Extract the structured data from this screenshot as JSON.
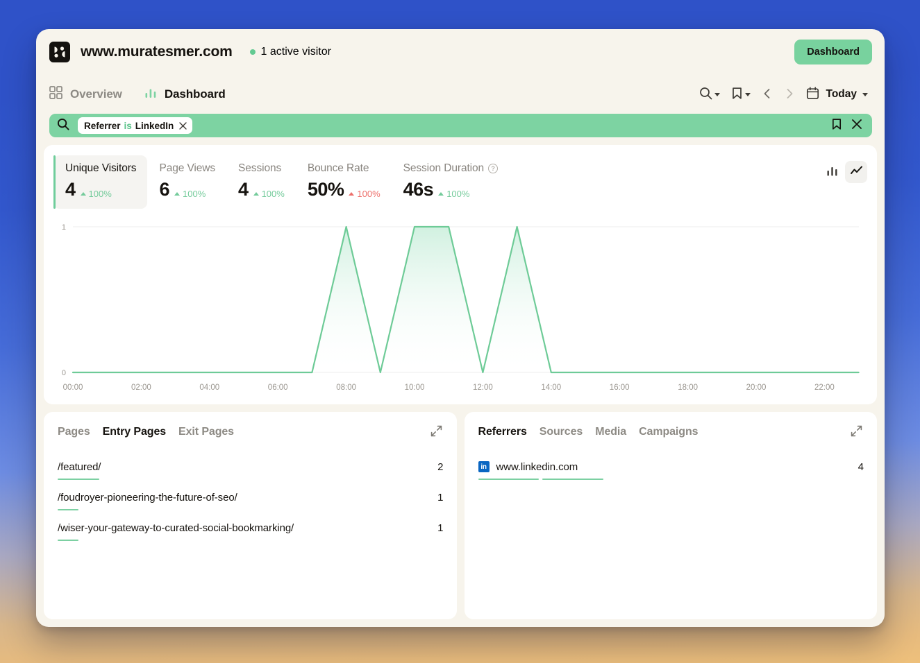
{
  "header": {
    "logo_icon": "plausible-logo-icon",
    "site_name": "www.muratesmer.com",
    "active_visitors": "1 active visitor",
    "dashboard_button": "Dashboard"
  },
  "nav": {
    "items": [
      {
        "label": "Overview",
        "icon": "grid-icon",
        "active": false
      },
      {
        "label": "Dashboard",
        "icon": "bar-chart-icon",
        "active": true
      }
    ],
    "search_icon": "search-icon",
    "bookmark_icon": "bookmark-icon",
    "prev_icon": "chevron-left-icon",
    "next_icon": "chevron-right-icon",
    "calendar_icon": "calendar-icon",
    "date_range": "Today"
  },
  "filter_bar": {
    "search_icon": "search-icon",
    "pill": {
      "key": "Referrer",
      "operator": "is",
      "value": "LinkedIn",
      "remove_icon": "close-icon"
    },
    "bookmark_icon": "bookmark-icon",
    "close_icon": "close-icon"
  },
  "metrics": [
    {
      "label": "Unique Visitors",
      "value": "4",
      "change": "100%",
      "direction": "up",
      "active": true,
      "has_help": false
    },
    {
      "label": "Page Views",
      "value": "6",
      "change": "100%",
      "direction": "up",
      "active": false,
      "has_help": false
    },
    {
      "label": "Sessions",
      "value": "4",
      "change": "100%",
      "direction": "up",
      "active": false,
      "has_help": false
    },
    {
      "label": "Bounce Rate",
      "value": "50%",
      "change": "100%",
      "direction": "down",
      "active": false,
      "has_help": false
    },
    {
      "label": "Session Duration",
      "value": "46s",
      "change": "100%",
      "direction": "up",
      "active": false,
      "has_help": true
    }
  ],
  "chart_toggles": [
    {
      "icon": "bar-chart-icon",
      "active": false
    },
    {
      "icon": "line-chart-icon",
      "active": true
    }
  ],
  "chart_data": {
    "type": "line",
    "title": "",
    "xlabel": "",
    "ylabel": "",
    "ylim": [
      0,
      1
    ],
    "ytick_labels": [
      "0",
      "1"
    ],
    "grid": true,
    "legend": "none",
    "series_name": "Unique Visitors",
    "line_color": "#6ecb97",
    "fill_color": "#d9f2e4",
    "x": [
      "00:00",
      "01:00",
      "02:00",
      "03:00",
      "04:00",
      "05:00",
      "06:00",
      "07:00",
      "08:00",
      "09:00",
      "10:00",
      "11:00",
      "12:00",
      "13:00",
      "14:00",
      "15:00",
      "16:00",
      "17:00",
      "18:00",
      "19:00",
      "20:00",
      "21:00",
      "22:00",
      "23:00"
    ],
    "values": [
      0,
      0,
      0,
      0,
      0,
      0,
      0,
      0,
      1,
      0,
      1,
      1,
      0,
      1,
      0,
      0,
      0,
      0,
      0,
      0,
      0,
      0,
      0,
      0
    ],
    "xtick_labels": [
      "00:00",
      "02:00",
      "04:00",
      "06:00",
      "08:00",
      "10:00",
      "12:00",
      "14:00",
      "16:00",
      "18:00",
      "20:00",
      "22:00"
    ]
  },
  "pages_panel": {
    "tabs": [
      {
        "label": "Pages",
        "active": false
      },
      {
        "label": "Entry Pages",
        "active": true
      },
      {
        "label": "Exit Pages",
        "active": false
      }
    ],
    "expand_icon": "expand-icon",
    "rows": [
      {
        "label": "/featured/",
        "count": "2",
        "bar_pct": 100
      },
      {
        "label": "/foudroyer-pioneering-the-future-of-seo/",
        "count": "1",
        "bar_pct": 50
      },
      {
        "label": "/wiser-your-gateway-to-curated-social-bookmarking/",
        "count": "1",
        "bar_pct": 50
      }
    ]
  },
  "referrers_panel": {
    "tabs": [
      {
        "label": "Referrers",
        "active": true
      },
      {
        "label": "Sources",
        "active": false
      },
      {
        "label": "Media",
        "active": false
      },
      {
        "label": "Campaigns",
        "active": false
      }
    ],
    "expand_icon": "expand-icon",
    "rows": [
      {
        "label": "www.linkedin.com",
        "count": "4",
        "favicon": "in",
        "favicon_color": "#0a66c2",
        "bar_pct": 100
      }
    ]
  },
  "colors": {
    "accent_green": "#7dd3a2",
    "line_green": "#6ecb97",
    "danger_red": "#ed6f6b",
    "window_bg": "#f7f4ec",
    "card_bg": "#ffffff",
    "bg_top": "#2f52c8",
    "bg_bottom": "#eec07b"
  }
}
